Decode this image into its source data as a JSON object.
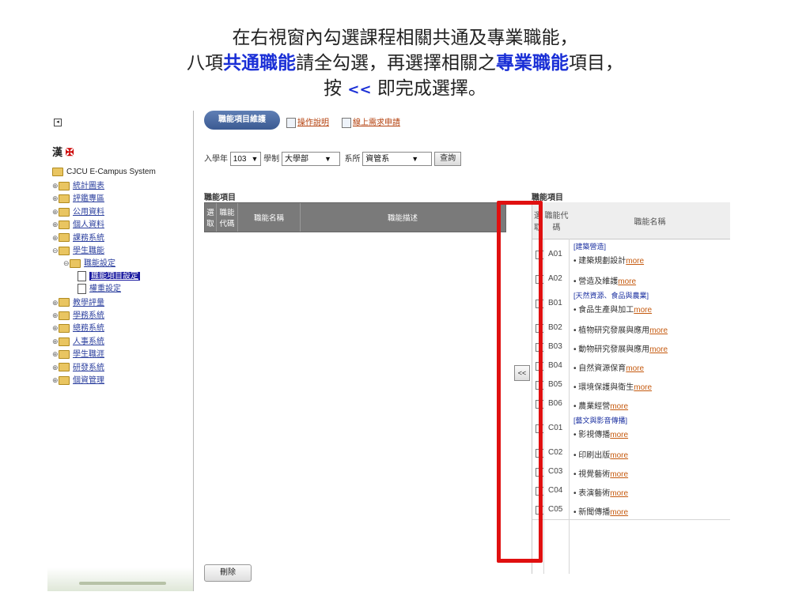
{
  "caption": {
    "line1": "在右視窗內勾選課程相關共通及專業職能，",
    "line2_a": "八項",
    "line2_b": "共通職能",
    "line2_c": "請全勾選，再選擇相關之",
    "line2_d": "專業職能",
    "line2_e": "項目，",
    "line3_a": "按 ",
    "line3_b": "<<",
    "line3_c": " 即完成選擇。"
  },
  "lang": {
    "label": "漢",
    "flag": "✠"
  },
  "tree": {
    "root": "CJCU E-Campus System",
    "items": [
      {
        "label": "統計圖表"
      },
      {
        "label": "評鑑專區"
      },
      {
        "label": "公用資料"
      },
      {
        "label": "個人資料"
      },
      {
        "label": "課務系統"
      },
      {
        "label": "學生職能"
      },
      {
        "label": "職能設定"
      },
      {
        "label": "職能項目設定"
      },
      {
        "label": "權重設定"
      },
      {
        "label": "教學評量"
      },
      {
        "label": "學務系統"
      },
      {
        "label": "總務系統"
      },
      {
        "label": "人事系統"
      },
      {
        "label": "學生職涯"
      },
      {
        "label": "研發系統"
      },
      {
        "label": "個資管理"
      }
    ]
  },
  "toolbar": {
    "tab_label": "職能項目維護",
    "help_link": "操作說明",
    "request_link": "線上需求申請"
  },
  "filters": {
    "year_label": "入學年",
    "year_value": "103",
    "system_label": "學制",
    "system_value": "大學部",
    "dept_label": "系所",
    "dept_value": "資管系",
    "query_button": "查詢"
  },
  "left_table": {
    "title": "職能項目",
    "headers": [
      "選取",
      "職能代碼",
      "職能名稱",
      "職能描述"
    ]
  },
  "move_button": "<<",
  "right_table": {
    "title": "職能項目",
    "headers": [
      "選取",
      "職能代碼",
      "職能名稱"
    ],
    "more": "more",
    "rows": [
      {
        "code": "A01",
        "group": "[建築營造]",
        "name": "建築規劃設計"
      },
      {
        "code": "A02",
        "group": "",
        "name": "營造及維護"
      },
      {
        "code": "B01",
        "group": "[天然資源、食品與農業]",
        "name": "食品生產與加工"
      },
      {
        "code": "B02",
        "group": "",
        "name": "植物研究發展與應用"
      },
      {
        "code": "B03",
        "group": "",
        "name": "動物研究發展與應用"
      },
      {
        "code": "B04",
        "group": "",
        "name": "自然資源保育"
      },
      {
        "code": "B05",
        "group": "",
        "name": "環境保護與衛生"
      },
      {
        "code": "B06",
        "group": "",
        "name": "農業經營"
      },
      {
        "code": "C01",
        "group": "[藝文與影音傳播]",
        "name": "影視傳播"
      },
      {
        "code": "C02",
        "group": "",
        "name": "印刷出版"
      },
      {
        "code": "C03",
        "group": "",
        "name": "視覺藝術"
      },
      {
        "code": "C04",
        "group": "",
        "name": "表演藝術"
      },
      {
        "code": "C05",
        "group": "",
        "name": "新聞傳播"
      }
    ]
  },
  "delete_button": "刪除",
  "colors": {
    "highlight_frame": "#e01010",
    "caption_blue": "#1a2fd6"
  }
}
